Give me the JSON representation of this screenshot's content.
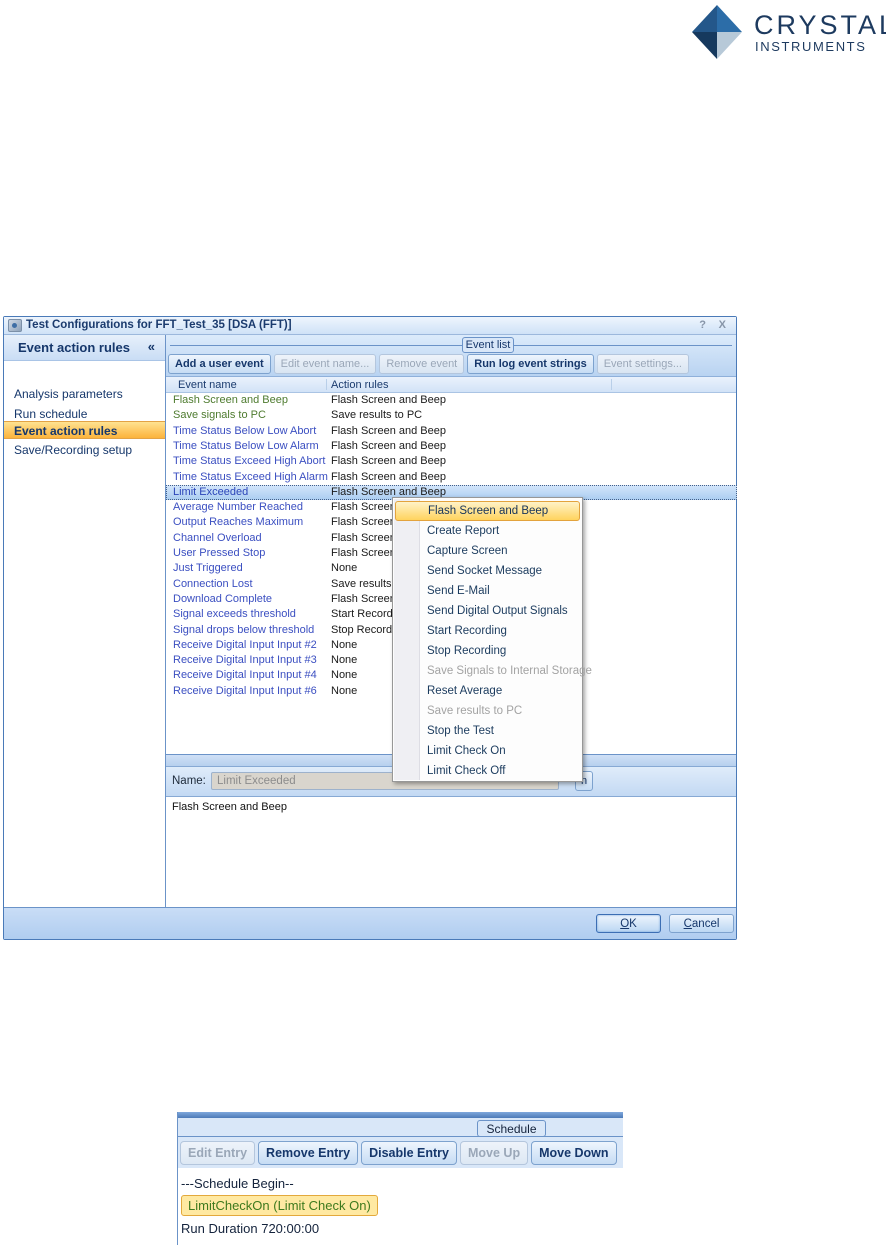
{
  "logo": {
    "line1": "CRYSTAL",
    "line2": "INSTRUMENTS"
  },
  "dialog": {
    "title": "Test Configurations for FFT_Test_35 [DSA (FFT)]",
    "help": "?",
    "close": "X",
    "sidebar": {
      "header": "Event action rules",
      "collapse": "«",
      "items": [
        {
          "label": "Analysis parameters",
          "selected": false
        },
        {
          "label": "Run schedule",
          "selected": false
        },
        {
          "label": "Event action rules",
          "selected": true
        },
        {
          "label": "Save/Recording setup",
          "selected": false
        }
      ]
    },
    "event_list": {
      "group_label": "Event list",
      "toolbar": [
        {
          "label": "Add a user event",
          "enabled": true
        },
        {
          "label": "Edit event name...",
          "enabled": false
        },
        {
          "label": "Remove event",
          "enabled": false
        },
        {
          "label": "Run log event strings",
          "enabled": true
        },
        {
          "label": "Event settings...",
          "enabled": false
        }
      ],
      "columns": [
        "Event name",
        "Action rules"
      ],
      "rows": [
        {
          "name": "Flash Screen and Beep",
          "action": "Flash Screen and Beep",
          "color": "green",
          "selected": false
        },
        {
          "name": "Save signals to PC",
          "action": "Save results to PC",
          "color": "green",
          "selected": false
        },
        {
          "name": "Time Status Below Low Abort",
          "action": "Flash Screen and Beep",
          "color": "blue",
          "selected": false
        },
        {
          "name": "Time Status Below Low Alarm",
          "action": "Flash Screen and Beep",
          "color": "blue",
          "selected": false
        },
        {
          "name": "Time Status Exceed High Abort",
          "action": "Flash Screen and Beep",
          "color": "blue",
          "selected": false
        },
        {
          "name": "Time Status Exceed High Alarm",
          "action": "Flash Screen and Beep",
          "color": "blue",
          "selected": false
        },
        {
          "name": "Limit Exceeded",
          "action": "Flash Screen and Beep",
          "color": "blue",
          "selected": true
        },
        {
          "name": "Average Number Reached",
          "action": "Flash Screen and Beep",
          "color": "blue",
          "selected": false
        },
        {
          "name": "Output Reaches Maximum",
          "action": "Flash Screen and Beep",
          "color": "blue",
          "selected": false
        },
        {
          "name": "Channel Overload",
          "action": "Flash Screen and Beep",
          "color": "blue",
          "selected": false
        },
        {
          "name": "User Pressed Stop",
          "action": "Flash Screen and Beep",
          "color": "blue",
          "selected": false
        },
        {
          "name": "Just Triggered",
          "action": "None",
          "color": "blue",
          "selected": false
        },
        {
          "name": "Connection Lost",
          "action": "Save results to PC",
          "color": "blue",
          "selected": false
        },
        {
          "name": "Download Complete",
          "action": "Flash Screen and Beep",
          "color": "blue",
          "selected": false
        },
        {
          "name": "Signal exceeds threshold",
          "action": "Start Recording",
          "color": "blue",
          "selected": false
        },
        {
          "name": "Signal drops below threshold",
          "action": "Stop Recording",
          "color": "blue",
          "selected": false
        },
        {
          "name": "Receive Digital Input Input #2",
          "action": "None",
          "color": "blue",
          "selected": false
        },
        {
          "name": "Receive Digital Input Input #3",
          "action": "None",
          "color": "blue",
          "selected": false
        },
        {
          "name": "Receive Digital Input Input #4",
          "action": "None",
          "color": "blue",
          "selected": false
        },
        {
          "name": "Receive Digital Input Input #6",
          "action": "None",
          "color": "blue",
          "selected": false
        }
      ]
    },
    "name_row": {
      "label": "Name:",
      "value": "Limit Exceeded",
      "partial_button": "n"
    },
    "description": "Flash Screen and Beep",
    "footer": {
      "ok": "OK",
      "cancel": "Cancel"
    }
  },
  "context_menu": {
    "items": [
      {
        "label": "Flash Screen and Beep",
        "state": "highlighted"
      },
      {
        "label": "Create Report",
        "state": "normal"
      },
      {
        "label": "Capture Screen",
        "state": "normal"
      },
      {
        "label": "Send Socket Message",
        "state": "normal"
      },
      {
        "label": "Send E-Mail",
        "state": "normal"
      },
      {
        "label": "Send Digital Output Signals",
        "state": "normal"
      },
      {
        "label": "Start Recording",
        "state": "normal"
      },
      {
        "label": "Stop Recording",
        "state": "normal"
      },
      {
        "label": "Save Signals to Internal Storage",
        "state": "disabled"
      },
      {
        "label": "Reset Average",
        "state": "normal"
      },
      {
        "label": "Save results to PC",
        "state": "disabled"
      },
      {
        "label": "Stop the Test",
        "state": "normal"
      },
      {
        "label": "Limit Check On",
        "state": "normal"
      },
      {
        "label": "Limit Check Off",
        "state": "normal"
      }
    ]
  },
  "schedule_panel": {
    "group_label": "Schedule",
    "toolbar": [
      {
        "label": "Edit Entry",
        "enabled": false
      },
      {
        "label": "Remove Entry",
        "enabled": true
      },
      {
        "label": "Disable Entry",
        "enabled": true
      },
      {
        "label": "Move Up",
        "enabled": false
      },
      {
        "label": "Move Down",
        "enabled": true
      }
    ],
    "entries": [
      {
        "text": "---Schedule Begin--",
        "highlighted": false
      },
      {
        "text": "LimitCheckOn (Limit Check On)",
        "highlighted": true
      },
      {
        "text": "Run Duration 720:00:00",
        "highlighted": false
      }
    ]
  },
  "colors": {
    "brand_navy": "#1d3a5f",
    "selection_orange": "#fcb33c",
    "row_selection_blue": "#aacdf1",
    "menu_highlight_yellow": "#ffd35e",
    "event_green_text": "#4e7b2f",
    "event_blue_text": "#3b4fc1",
    "schedule_highlight": "#ffe9a2"
  }
}
